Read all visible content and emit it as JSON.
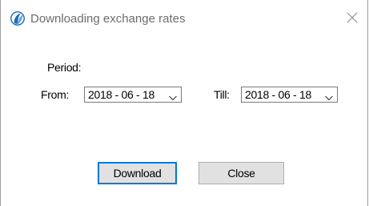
{
  "window": {
    "title": "Downloading exchange rates",
    "close_glyph": "✕"
  },
  "form": {
    "period_label": "Period:",
    "from_label": "From:",
    "from_value": "2018 - 06 - 18",
    "till_label": "Till:",
    "till_value": "2018 - 06 - 18"
  },
  "buttons": {
    "download_label": "Download",
    "close_label": "Close"
  },
  "colors": {
    "accent": "#0078d7",
    "icon_blue": "#1e6bb8",
    "title_text": "#6d6d6d",
    "button_face": "#e1e1e1"
  },
  "icons": {
    "app": "app-logo-icon",
    "close": "close-icon",
    "dropdown": "chevron-down-icon"
  }
}
